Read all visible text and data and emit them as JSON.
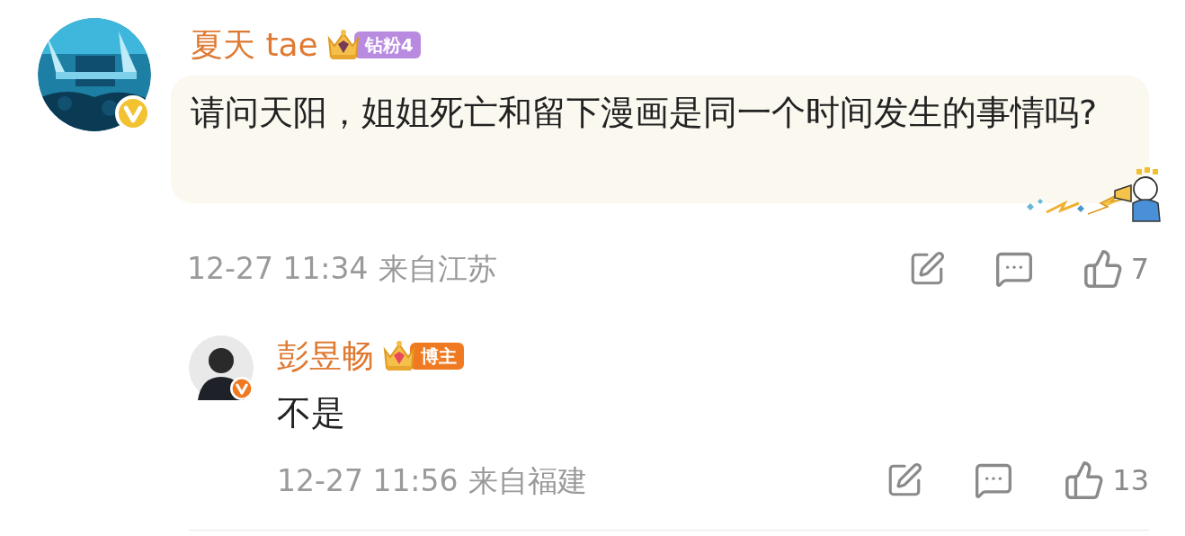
{
  "comment": {
    "name": "夏天 tae",
    "badge": {
      "kind": "diamond_fan",
      "text": "钻粉4"
    },
    "avatar_badge": {
      "kind": "gold"
    },
    "text": "请问天阳，姐姐死亡和留下漫画是同一个时间发生的事情吗?",
    "time": "12-27 11:34",
    "location": "来自江苏",
    "like_count": "7"
  },
  "reply": {
    "name": "彭昱畅",
    "badge": {
      "kind": "blogger",
      "text": "博主"
    },
    "avatar_badge": {
      "kind": "orange"
    },
    "text": "不是",
    "time": "12-27 11:56",
    "location": "来自福建",
    "like_count": "13"
  }
}
